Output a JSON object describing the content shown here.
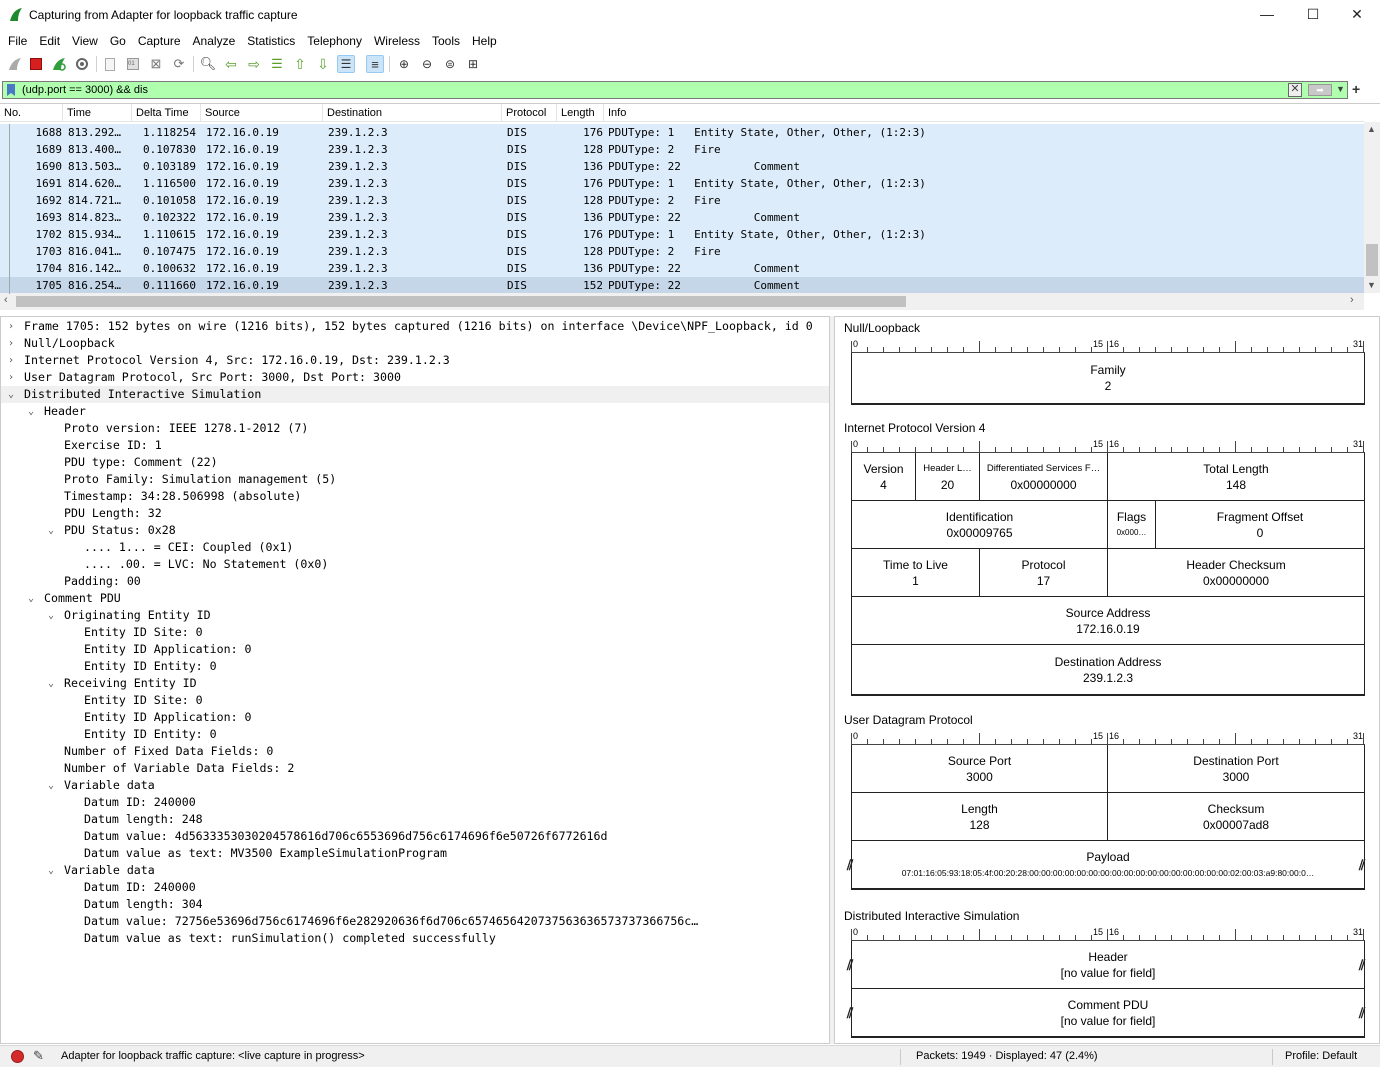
{
  "window": {
    "title": "Capturing from Adapter for loopback traffic capture",
    "minimize": "—",
    "maximize": "☐",
    "close": "✕"
  },
  "menu": [
    "File",
    "Edit",
    "View",
    "Go",
    "Capture",
    "Analyze",
    "Statistics",
    "Telephony",
    "Wireless",
    "Tools",
    "Help"
  ],
  "toolbar_icons": [
    "shark-fin-start-icon",
    "stop-capture-icon",
    "restart-capture-icon",
    "capture-options-icon",
    "open-file-icon",
    "save-file-icon",
    "close-file-icon",
    "reload-file-icon",
    "find-packet-icon",
    "go-back-icon",
    "go-forward-icon",
    "go-to-packet-icon",
    "go-first-packet-icon",
    "go-last-packet-icon",
    "autoscroll-icon",
    "colorize-icon",
    "zoom-in-icon",
    "zoom-out-icon",
    "zoom-normal-icon",
    "resize-columns-icon"
  ],
  "filter": {
    "value": "(udp.port == 3000) && dis",
    "bg_color": "#afffaf"
  },
  "packet_list": {
    "columns": [
      "No.",
      "Time",
      "Delta Time",
      "Source",
      "Destination",
      "Protocol",
      "Length",
      "Info"
    ],
    "rows": [
      {
        "no": "1688",
        "time": "813.292…",
        "delta": "1.118254",
        "src": "172.16.0.19",
        "dst": "239.1.2.3",
        "proto": "DIS",
        "len": "176",
        "info": "PDUType: 1   Entity State, Other, Other, (1:2:3)"
      },
      {
        "no": "1689",
        "time": "813.400…",
        "delta": "0.107830",
        "src": "172.16.0.19",
        "dst": "239.1.2.3",
        "proto": "DIS",
        "len": "128",
        "info": "PDUType: 2   Fire"
      },
      {
        "no": "1690",
        "time": "813.503…",
        "delta": "0.103189",
        "src": "172.16.0.19",
        "dst": "239.1.2.3",
        "proto": "DIS",
        "len": "136",
        "info": "PDUType: 22           Comment"
      },
      {
        "no": "1691",
        "time": "814.620…",
        "delta": "1.116500",
        "src": "172.16.0.19",
        "dst": "239.1.2.3",
        "proto": "DIS",
        "len": "176",
        "info": "PDUType: 1   Entity State, Other, Other, (1:2:3)"
      },
      {
        "no": "1692",
        "time": "814.721…",
        "delta": "0.101058",
        "src": "172.16.0.19",
        "dst": "239.1.2.3",
        "proto": "DIS",
        "len": "128",
        "info": "PDUType: 2   Fire"
      },
      {
        "no": "1693",
        "time": "814.823…",
        "delta": "0.102322",
        "src": "172.16.0.19",
        "dst": "239.1.2.3",
        "proto": "DIS",
        "len": "136",
        "info": "PDUType: 22           Comment"
      },
      {
        "no": "1702",
        "time": "815.934…",
        "delta": "1.110615",
        "src": "172.16.0.19",
        "dst": "239.1.2.3",
        "proto": "DIS",
        "len": "176",
        "info": "PDUType: 1   Entity State, Other, Other, (1:2:3)"
      },
      {
        "no": "1703",
        "time": "816.041…",
        "delta": "0.107475",
        "src": "172.16.0.19",
        "dst": "239.1.2.3",
        "proto": "DIS",
        "len": "128",
        "info": "PDUType: 2   Fire"
      },
      {
        "no": "1704",
        "time": "816.142…",
        "delta": "0.100632",
        "src": "172.16.0.19",
        "dst": "239.1.2.3",
        "proto": "DIS",
        "len": "136",
        "info": "PDUType: 22           Comment"
      },
      {
        "no": "1705",
        "time": "816.254…",
        "delta": "0.111660",
        "src": "172.16.0.19",
        "dst": "239.1.2.3",
        "proto": "DIS",
        "len": "152",
        "info": "PDUType: 22           Comment",
        "selected": true
      }
    ],
    "row_color": "#dcecfb",
    "selected_color": "#c4d6e8"
  },
  "details": [
    {
      "lvl": 0,
      "exp": "›",
      "text": "Frame 1705: 152 bytes on wire (1216 bits), 152 bytes captured (1216 bits) on interface \\Device\\NPF_Loopback, id 0"
    },
    {
      "lvl": 0,
      "exp": "›",
      "text": "Null/Loopback"
    },
    {
      "lvl": 0,
      "exp": "›",
      "text": "Internet Protocol Version 4, Src: 172.16.0.19, Dst: 239.1.2.3"
    },
    {
      "lvl": 0,
      "exp": "›",
      "text": "User Datagram Protocol, Src Port: 3000, Dst Port: 3000"
    },
    {
      "lvl": 0,
      "exp": "⌄",
      "text": "Distributed Interactive Simulation",
      "hl": true
    },
    {
      "lvl": 1,
      "exp": "⌄",
      "text": "Header"
    },
    {
      "lvl": 2,
      "exp": "",
      "text": "Proto version: IEEE 1278.1-2012 (7)"
    },
    {
      "lvl": 2,
      "exp": "",
      "text": "Exercise ID: 1"
    },
    {
      "lvl": 2,
      "exp": "",
      "text": "PDU type: Comment (22)"
    },
    {
      "lvl": 2,
      "exp": "",
      "text": "Proto Family: Simulation management (5)"
    },
    {
      "lvl": 2,
      "exp": "",
      "text": "Timestamp: 34:28.506998 (absolute)"
    },
    {
      "lvl": 2,
      "exp": "",
      "text": "PDU Length: 32"
    },
    {
      "lvl": 2,
      "exp": "⌄",
      "text": "PDU Status: 0x28"
    },
    {
      "lvl": 3,
      "exp": "",
      "text": ".... 1... = CEI: Coupled (0x1)"
    },
    {
      "lvl": 3,
      "exp": "",
      "text": ".... .00. = LVC: No Statement (0x0)"
    },
    {
      "lvl": 2,
      "exp": "",
      "text": "Padding: 00"
    },
    {
      "lvl": 1,
      "exp": "⌄",
      "text": "Comment PDU"
    },
    {
      "lvl": 2,
      "exp": "⌄",
      "text": "Originating Entity ID"
    },
    {
      "lvl": 3,
      "exp": "",
      "text": "Entity ID Site: 0"
    },
    {
      "lvl": 3,
      "exp": "",
      "text": "Entity ID Application: 0"
    },
    {
      "lvl": 3,
      "exp": "",
      "text": "Entity ID Entity: 0"
    },
    {
      "lvl": 2,
      "exp": "⌄",
      "text": "Receiving Entity ID"
    },
    {
      "lvl": 3,
      "exp": "",
      "text": "Entity ID Site: 0"
    },
    {
      "lvl": 3,
      "exp": "",
      "text": "Entity ID Application: 0"
    },
    {
      "lvl": 3,
      "exp": "",
      "text": "Entity ID Entity: 0"
    },
    {
      "lvl": 2,
      "exp": "",
      "text": "Number of Fixed Data Fields: 0"
    },
    {
      "lvl": 2,
      "exp": "",
      "text": "Number of Variable Data Fields: 2"
    },
    {
      "lvl": 2,
      "exp": "⌄",
      "text": "Variable data"
    },
    {
      "lvl": 3,
      "exp": "",
      "text": "Datum ID: 240000"
    },
    {
      "lvl": 3,
      "exp": "",
      "text": "Datum length: 248"
    },
    {
      "lvl": 3,
      "exp": "",
      "text": "Datum value: 4d5633353030204578616d706c6553696d756c6174696f6e50726f6772616d"
    },
    {
      "lvl": 3,
      "exp": "",
      "text": "Datum value as text: MV3500 ExampleSimulationProgram"
    },
    {
      "lvl": 2,
      "exp": "⌄",
      "text": "Variable data"
    },
    {
      "lvl": 3,
      "exp": "",
      "text": "Datum ID: 240000"
    },
    {
      "lvl": 3,
      "exp": "",
      "text": "Datum length: 304"
    },
    {
      "lvl": 3,
      "exp": "",
      "text": "Datum value: 72756e53696d756c6174696f6e282920636f6d706c6574656420737563636573737366756c…"
    },
    {
      "lvl": 3,
      "exp": "",
      "text": "Datum value as text: runSimulation() completed successfully"
    }
  ],
  "diagram": {
    "ruler": {
      "start": "0",
      "mid_a": "15",
      "mid_b": "16",
      "end": "31"
    },
    "null_loopback": {
      "title": "Null/Loopback",
      "family_label": "Family",
      "family_value": "2"
    },
    "ipv4": {
      "title": "Internet Protocol Version 4",
      "version_label": "Version",
      "version_value": "4",
      "hl_label": "Header L…",
      "hl_value": "20",
      "dsf_label": "Differentiated Services F…",
      "dsf_value": "0x00000000",
      "tl_label": "Total Length",
      "tl_value": "148",
      "id_label": "Identification",
      "id_value": "0x00009765",
      "flags_label": "Flags",
      "flags_value": "0x000…",
      "fo_label": "Fragment Offset",
      "fo_value": "0",
      "ttl_label": "Time to Live",
      "ttl_value": "1",
      "proto_label": "Protocol",
      "proto_value": "17",
      "cks_label": "Header Checksum",
      "cks_value": "0x00000000",
      "src_label": "Source Address",
      "src_value": "172.16.0.19",
      "dst_label": "Destination Address",
      "dst_value": "239.1.2.3"
    },
    "udp": {
      "title": "User Datagram Protocol",
      "sp_label": "Source Port",
      "sp_value": "3000",
      "dp_label": "Destination Port",
      "dp_value": "3000",
      "len_label": "Length",
      "len_value": "128",
      "cks_label": "Checksum",
      "cks_value": "0x00007ad8",
      "pl_label": "Payload",
      "pl_value": "07:01:16:05:93:18:05:4f:00:20:28:00:00:00:00:00:00:00:00:00:00:00:00:00:00:00:00:00:02:00:03:a9:80:00:0…"
    },
    "dis": {
      "title": "Distributed Interactive Simulation",
      "hdr_label": "Header",
      "hdr_value": "[no value for field]",
      "cpdu_label": "Comment PDU",
      "cpdu_value": "[no value for field]"
    }
  },
  "status": {
    "message": "Adapter for loopback traffic capture: <live capture in progress>",
    "packets": "Packets: 1949 · Displayed: 47 (2.4%)",
    "profile": "Profile: Default"
  }
}
